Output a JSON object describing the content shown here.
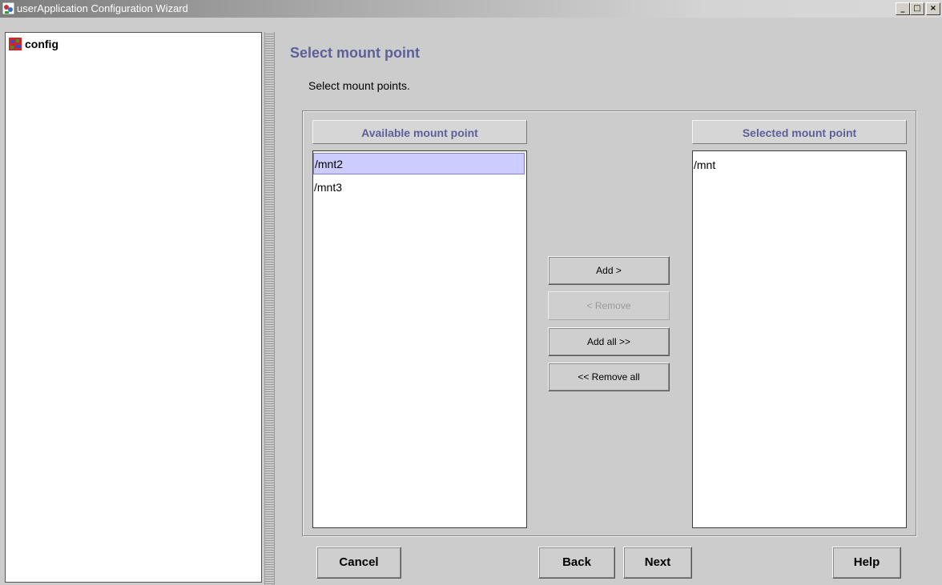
{
  "window": {
    "title": "userApplication Configuration Wizard",
    "controls": {
      "minimize": "_",
      "maximize": "□",
      "close": "×"
    }
  },
  "tree": {
    "root_label": "config",
    "root_icon": "config-node-icon"
  },
  "page": {
    "title": "Select mount point",
    "instruction": "Select mount points."
  },
  "available": {
    "header": "Available mount point",
    "items": [
      "/mnt2",
      "/mnt3"
    ],
    "selected_item": "/mnt2"
  },
  "selected": {
    "header": "Selected mount point",
    "items": [
      "/mnt"
    ]
  },
  "transfer_buttons": {
    "add": "Add >",
    "remove": "< Remove",
    "add_all": "Add all >>",
    "remove_all": "<< Remove all"
  },
  "footer": {
    "cancel": "Cancel",
    "back": "Back",
    "next": "Next",
    "help": "Help"
  },
  "colors": {
    "accent_text": "#5d5f9a",
    "selection": "#ccccff",
    "background": "#cccccc"
  }
}
